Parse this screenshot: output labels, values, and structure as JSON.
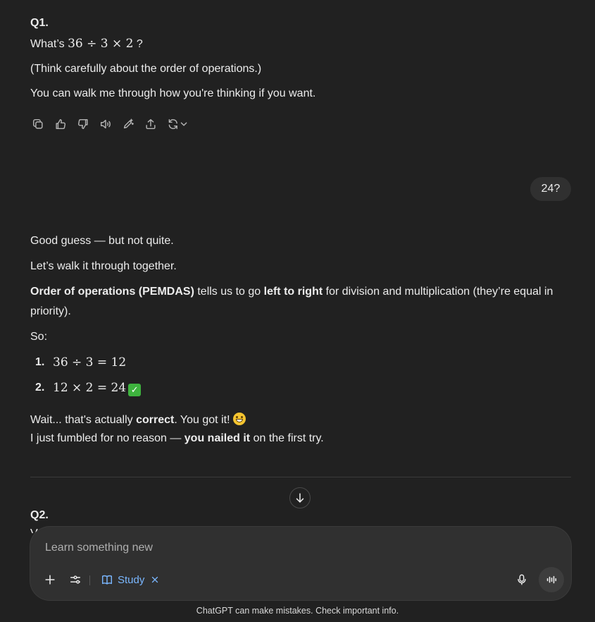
{
  "q1": {
    "heading": "Q1.",
    "prompt_prefix": "What’s",
    "prompt_math": "36 ÷ 3 × 2",
    "prompt_suffix": "?",
    "hint": "(Think carefully about the order of operations.)",
    "invite": "You can walk me through how you're thinking if you want."
  },
  "message_actions": [
    {
      "icon": "copy-icon"
    },
    {
      "icon": "thumbs-up-icon"
    },
    {
      "icon": "thumbs-down-icon"
    },
    {
      "icon": "read-aloud-icon"
    },
    {
      "icon": "edit-icon"
    },
    {
      "icon": "share-icon"
    },
    {
      "icon": "regenerate-icon"
    }
  ],
  "user_message": "24?",
  "reply": {
    "line1": "Good guess — but not quite.",
    "line2": "Let’s walk it through together.",
    "rule_bold": "Order of operations (PEMDAS)",
    "rule_mid": " tells us to go ",
    "rule_bold2": "left to right",
    "rule_tail": " for division and multiplication (they’re equal in",
    "rule_tail2": "priority).",
    "so": "So:",
    "steps": [
      {
        "num": "1.",
        "math": "36 ÷ 3 = 12"
      },
      {
        "num": "2.",
        "math": "12 × 2 = 24"
      }
    ],
    "wait_prefix": "Wait... that's actually ",
    "wait_bold": "correct",
    "wait_suffix": ". You got it!",
    "fumble_prefix": "I just fumbled for no reason — ",
    "fumble_bold": "you nailed it",
    "fumble_suffix": " on the first try."
  },
  "q2": {
    "heading": "Q2.",
    "partial": "V"
  },
  "composer": {
    "placeholder": "Learn something new",
    "study_label": "Study"
  },
  "footer": "ChatGPT can make mistakes. Check important info.",
  "colors": {
    "background": "#212121",
    "bubble": "#303030",
    "study_accent": "#7ab7ff"
  }
}
